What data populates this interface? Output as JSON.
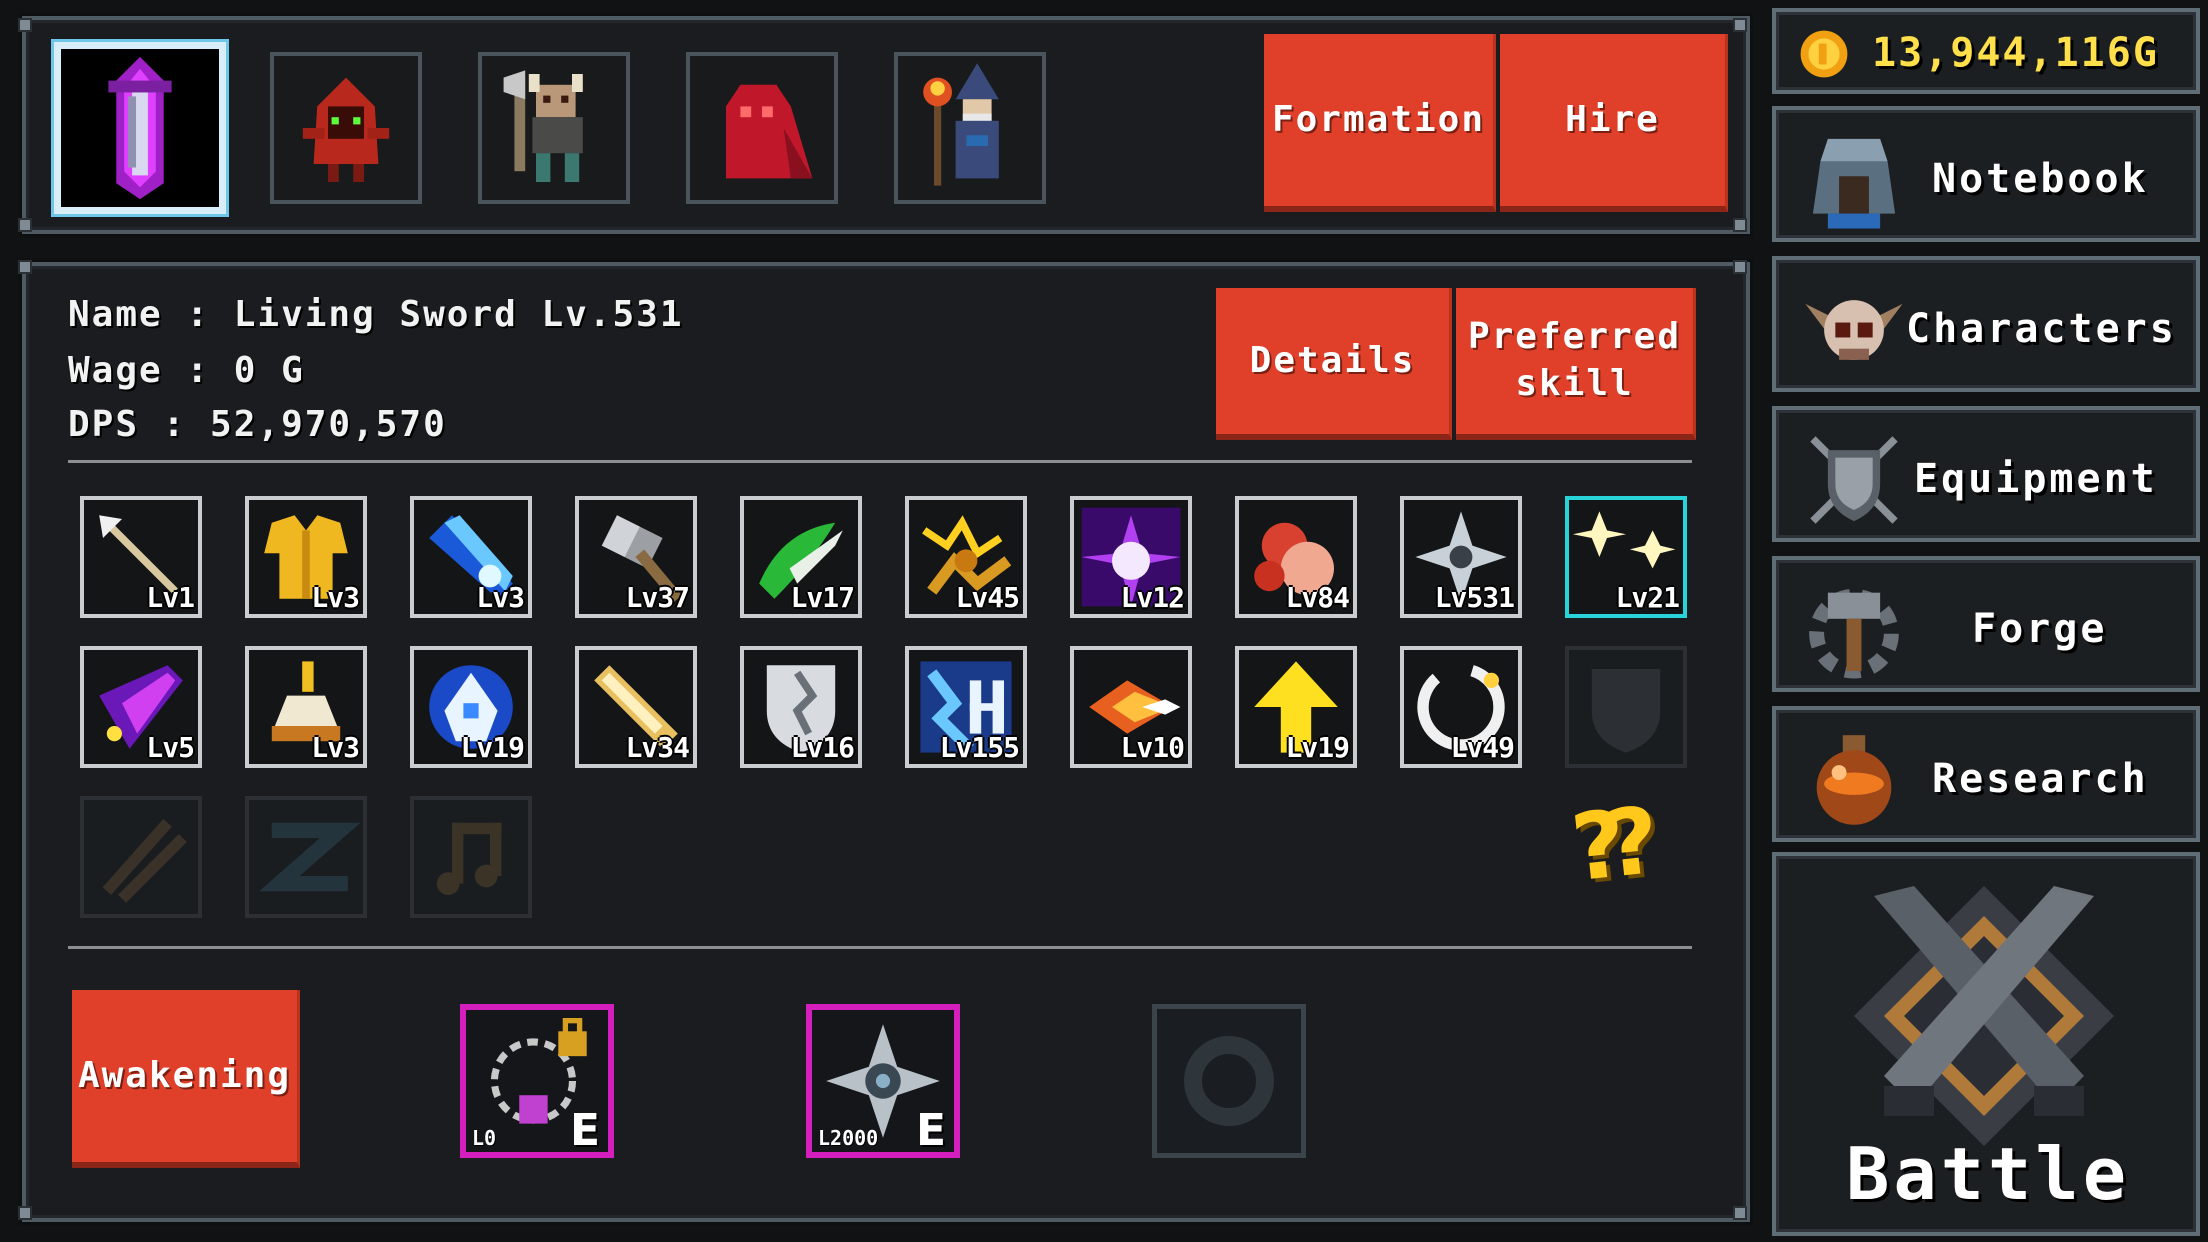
{
  "gold": {
    "amount": "13,944,116G"
  },
  "party": [
    {
      "id": "living-sword",
      "selected": true
    },
    {
      "id": "red-hood-goblin",
      "selected": false
    },
    {
      "id": "horned-warrior",
      "selected": false
    },
    {
      "id": "red-slime-ghost",
      "selected": false
    },
    {
      "id": "fire-wizard",
      "selected": false
    }
  ],
  "top_buttons": {
    "formation": "Formation",
    "hire": "Hire"
  },
  "character": {
    "name": "Name : Living Sword Lv.531",
    "wage": "Wage : 0 G",
    "dps": "DPS : 52,970,570"
  },
  "char_buttons": {
    "details": "Details",
    "preferred_line1": "Preferred",
    "preferred_line2": "skill"
  },
  "skills_row1": [
    "Lv1",
    "Lv3",
    "Lv3",
    "Lv37",
    "Lv17",
    "Lv45",
    "Lv12",
    "Lv84",
    "Lv531",
    "Lv21"
  ],
  "skills_row2": [
    "Lv5",
    "Lv3",
    "Lv19",
    "Lv34",
    "Lv16",
    "Lv155",
    "Lv10",
    "Lv19",
    "Lv49"
  ],
  "unknown_marker": "??",
  "awakening": "Awakening",
  "runes": [
    {
      "level": "L0",
      "grade": "E"
    },
    {
      "level": "L2000",
      "grade": "E"
    }
  ],
  "side_menu": {
    "notebook": "Notebook",
    "characters": "Characters",
    "equipment": "Equipment",
    "forge": "Forge",
    "research": "Research",
    "battle": "Battle"
  },
  "colors": {
    "button": "#e0402a",
    "gold": "#ffe04a",
    "highlight": "#28d3da",
    "rune": "#d41ebd"
  }
}
